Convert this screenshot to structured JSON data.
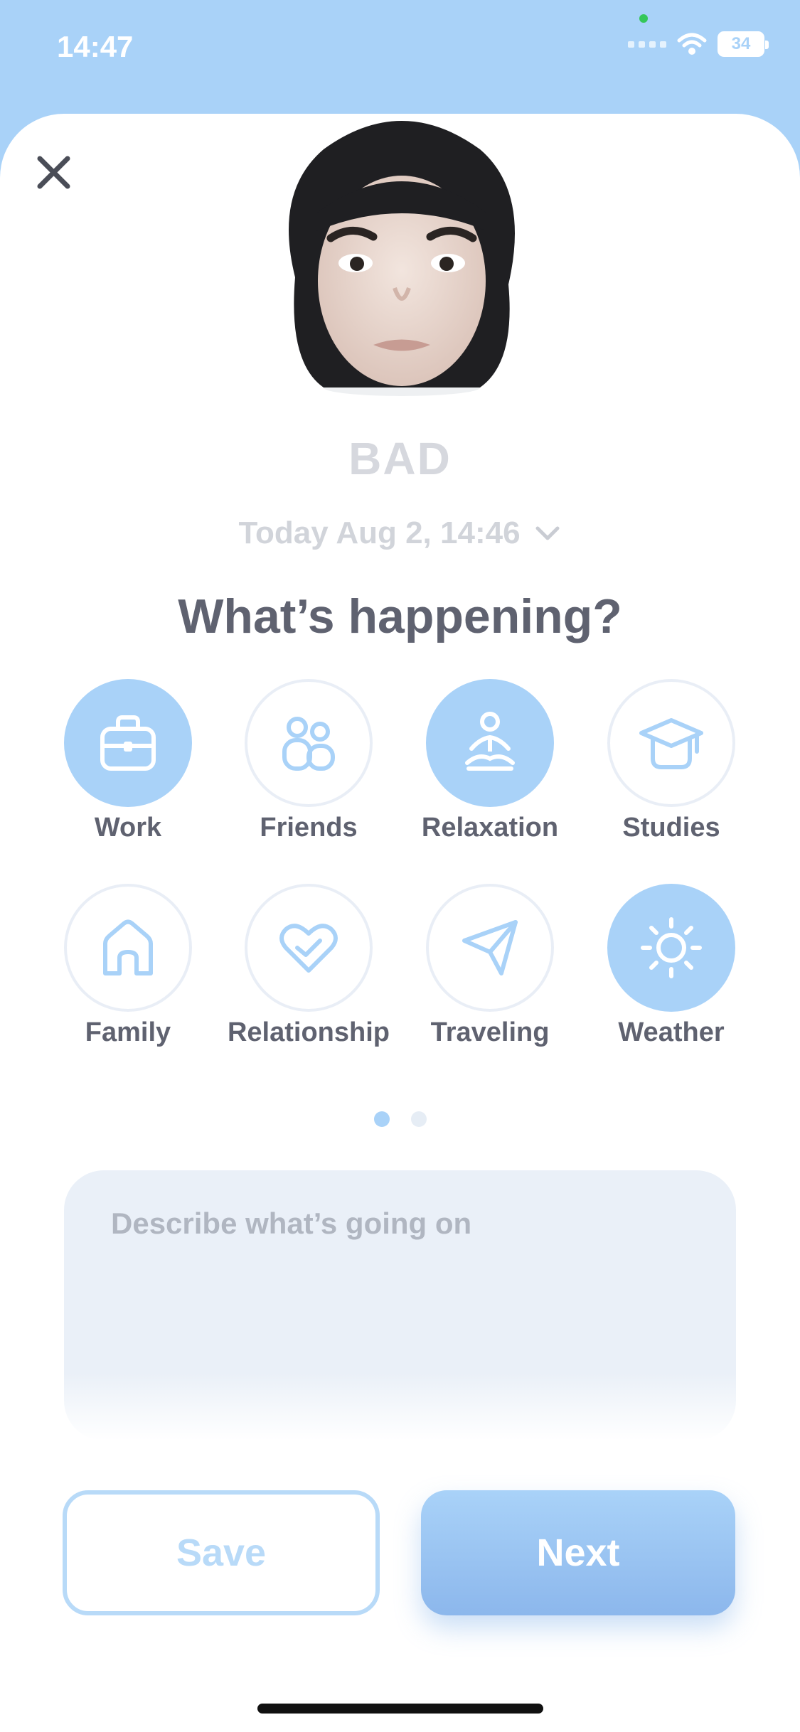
{
  "status_bar": {
    "time": "14:47",
    "battery": "34"
  },
  "sheet": {
    "close_icon": "close-icon",
    "mood": "BAD",
    "date": "Today Aug 2, 14:46",
    "heading": "What’s happening?"
  },
  "categories": [
    {
      "label": "Work",
      "icon": "briefcase-icon",
      "selected": true
    },
    {
      "label": "Friends",
      "icon": "people-icon",
      "selected": false
    },
    {
      "label": "Relaxation",
      "icon": "meditation-icon",
      "selected": true
    },
    {
      "label": "Studies",
      "icon": "graduation-cap-icon",
      "selected": false
    },
    {
      "label": "Family",
      "icon": "home-icon",
      "selected": false
    },
    {
      "label": "Relationship",
      "icon": "heart-icon",
      "selected": false
    },
    {
      "label": "Traveling",
      "icon": "send-icon",
      "selected": false
    },
    {
      "label": "Weather",
      "icon": "sun-icon",
      "selected": true
    }
  ],
  "pager": {
    "pages": 2,
    "current": 1
  },
  "description": {
    "placeholder": "Describe what’s going on",
    "value": ""
  },
  "buttons": {
    "save": "Save",
    "next": "Next"
  },
  "colors": {
    "accent": "#a9d2f8",
    "text": "#5f6270",
    "muted": "#d1d4da",
    "next_gradient_end": "#8cb7ec"
  }
}
